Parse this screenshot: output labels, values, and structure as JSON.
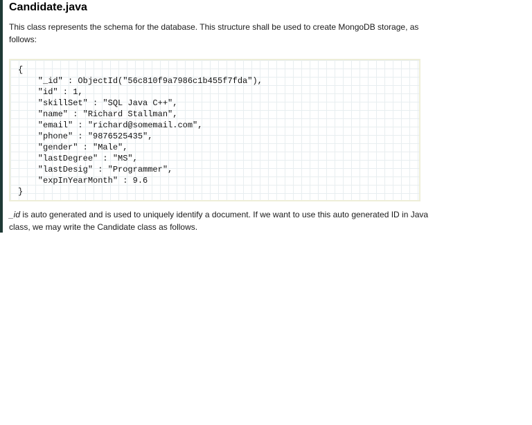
{
  "title": "Candidate.java",
  "intro_text": "This class represents the schema for the database. This structure shall be used to create MongoDB storage, as follows:",
  "code": {
    "lines": [
      "{",
      "    \"_id\" : ObjectId(\"56c810f9a7986c1b455f7fda\"),",
      "    \"id\" : 1,",
      "    \"skillSet\" : \"SQL Java C++\",",
      "    \"name\" : \"Richard Stallman\",",
      "    \"email\" : \"richard@somemail.com\",",
      "    \"phone\" : \"9876525435\",",
      "    \"gender\" : \"Male\",",
      "    \"lastDegree\" : \"MS\",",
      "    \"lastDesig\" : \"Programmer\",",
      "    \"expInYearMonth\" : 9.6",
      "}"
    ]
  },
  "outro": {
    "emphasis": "_id",
    "text": " is auto generated and is used to uniquely identify a document. If we want to use this auto generated ID in Java class, we may write the Candidate class as follows."
  }
}
